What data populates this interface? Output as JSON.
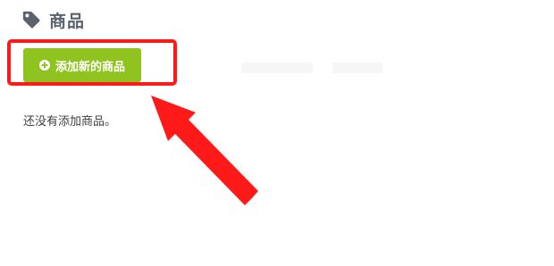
{
  "section": {
    "title": "商品",
    "icon": "tag-icon"
  },
  "add_button": {
    "icon": "plus-circle-icon",
    "label": "添加新的商品"
  },
  "empty_state": {
    "message": "还没有添加商品。"
  },
  "annotation": {
    "box_color": "#ff1a1a",
    "arrow_color": "#ff1a1a"
  },
  "colors": {
    "accent": "#8fc320",
    "title": "#5b626d"
  }
}
